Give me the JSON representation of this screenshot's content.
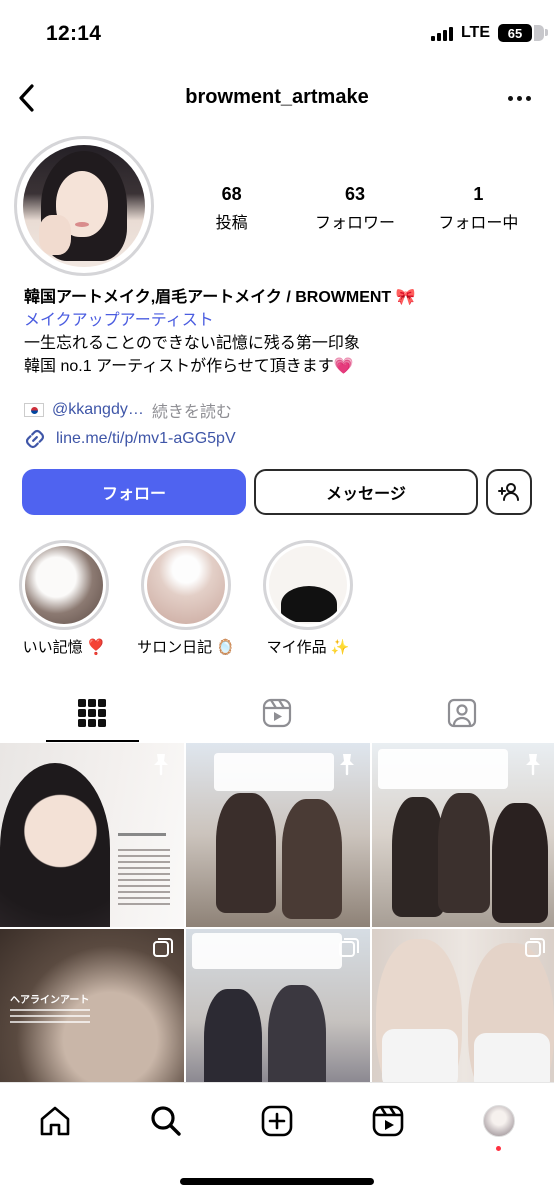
{
  "status_bar": {
    "time": "12:14",
    "network": "LTE",
    "battery": "65"
  },
  "header": {
    "username": "browment_artmake"
  },
  "profile": {
    "stats": [
      {
        "num": "68",
        "label": "投稿"
      },
      {
        "num": "63",
        "label": "フォロワー"
      },
      {
        "num": "1",
        "label": "フォロー中"
      }
    ],
    "bio": {
      "name": "韓国アートメイク,眉毛アートメイク / BROWMENT 🎀",
      "category": "メイクアップアーティスト",
      "line1": "一生忘れることのできない記憶に残る第一印象",
      "line2": "韓国 no.1 アーティストが作らせて頂きます💗",
      "mention": "@kkangdy…",
      "read_more": "続きを読む",
      "link": "line.me/ti/p/mv1-aGG5pV"
    }
  },
  "buttons": {
    "follow": "フォロー",
    "message": "メッセージ"
  },
  "highlights": [
    {
      "label": "いい記憶 ❣️"
    },
    {
      "label": "サロン日記 🪞"
    },
    {
      "label": "マイ作品 ✨"
    }
  ],
  "posts": {
    "tile4_label": "ヘアラインアート"
  }
}
